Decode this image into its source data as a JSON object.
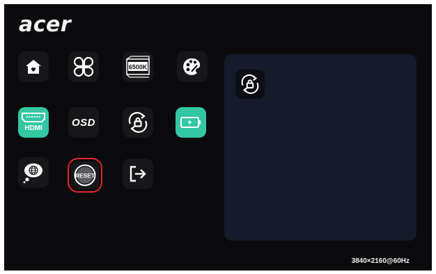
{
  "brand": {
    "logo": "acer"
  },
  "menu": {
    "items": [
      {
        "name": "home",
        "icon": "home-icon"
      },
      {
        "name": "mode",
        "icon": "four-petal-icon"
      },
      {
        "name": "color-temp",
        "icon": "color-temp-icon",
        "label": "6500K"
      },
      {
        "name": "color",
        "icon": "palette-icon"
      },
      {
        "name": "input",
        "icon": "hdmi-icon",
        "label": "HDMI"
      },
      {
        "name": "osd",
        "icon": "osd-icon",
        "label": "OSD"
      },
      {
        "name": "osd-lock",
        "icon": "lock-rotate-icon"
      },
      {
        "name": "power",
        "icon": "battery-icon"
      },
      {
        "name": "language",
        "icon": "globe-bubble-icon"
      },
      {
        "name": "reset",
        "icon": "reset-icon",
        "label": "RESET",
        "selected": true
      },
      {
        "name": "exit",
        "icon": "exit-icon"
      }
    ]
  },
  "detail_panel": {
    "icon": "lock-rotate-icon"
  },
  "status": {
    "resolution": "3840×2160@60Hz"
  },
  "colors": {
    "accent_teal": "#33c7a3",
    "selection_red": "#e3272f",
    "panel_bg": "#161a2a"
  }
}
